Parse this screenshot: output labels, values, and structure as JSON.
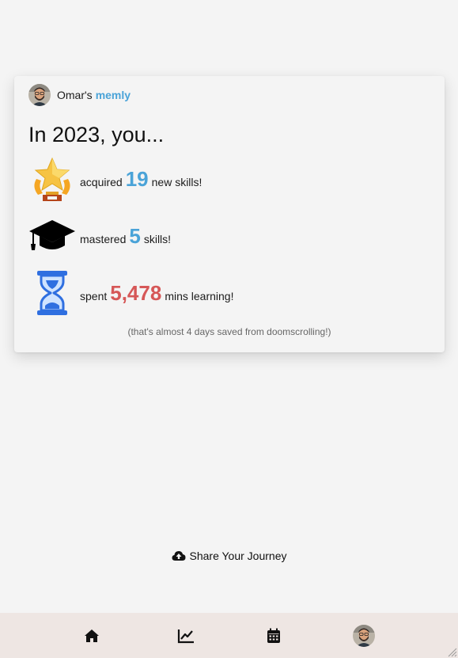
{
  "profile": {
    "owner_name": "Omar's",
    "brand": "memly",
    "avatar_icon": "user-avatar"
  },
  "recap": {
    "headline": "In 2023, you...",
    "stats": [
      {
        "icon": "trophy-star-icon",
        "prefix": "acquired",
        "value": "19",
        "suffix": "new skills!",
        "color": "#4aa3d8"
      },
      {
        "icon": "graduation-cap-icon",
        "prefix": "mastered",
        "value": "5",
        "suffix": "skills!",
        "color": "#4aa3d8"
      },
      {
        "icon": "hourglass-icon",
        "prefix": "spent",
        "value": "5,478",
        "suffix": "mins learning!",
        "color": "#d65757"
      }
    ],
    "note": "(that's almost 4 days saved from doomscrolling!)"
  },
  "share": {
    "label": "Share Your Journey",
    "icon": "cloud-upload-icon"
  },
  "bottom_nav": {
    "items": [
      {
        "icon": "home-icon"
      },
      {
        "icon": "chart-line-icon"
      },
      {
        "icon": "calendar-icon"
      },
      {
        "icon": "profile-avatar"
      }
    ]
  }
}
